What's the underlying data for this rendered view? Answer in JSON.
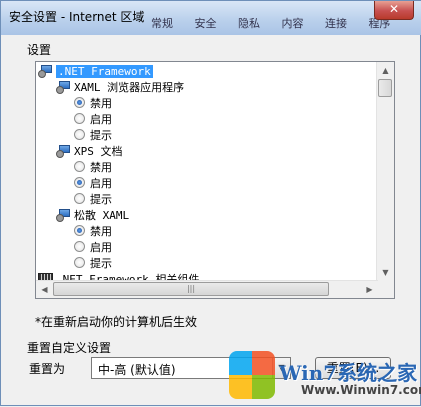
{
  "window": {
    "title": "安全设置 - Internet 区域",
    "close_glyph": "✕",
    "background_tabs": [
      "常规",
      "安全",
      "隐私",
      "内容",
      "连接",
      "程序"
    ]
  },
  "settings": {
    "label": "设置",
    "tree": [
      {
        "kind": "category",
        "label": ".NET Framework",
        "icon": "settings-category-icon",
        "selected": true
      },
      {
        "kind": "subcategory",
        "label": "XAML 浏览器应用程序",
        "icon": "settings-category-icon"
      },
      {
        "kind": "option",
        "label": "禁用",
        "checked": true
      },
      {
        "kind": "option",
        "label": "启用",
        "checked": false
      },
      {
        "kind": "option",
        "label": "提示",
        "checked": false
      },
      {
        "kind": "subcategory",
        "label": "XPS 文档",
        "icon": "settings-category-icon"
      },
      {
        "kind": "option",
        "label": "禁用",
        "checked": false
      },
      {
        "kind": "option",
        "label": "启用",
        "checked": true
      },
      {
        "kind": "option",
        "label": "提示",
        "checked": false
      },
      {
        "kind": "subcategory",
        "label": "松散 XAML",
        "icon": "settings-category-icon"
      },
      {
        "kind": "option",
        "label": "禁用",
        "checked": true
      },
      {
        "kind": "option",
        "label": "启用",
        "checked": false
      },
      {
        "kind": "option",
        "label": "提示",
        "checked": false
      },
      {
        "kind": "category",
        "label": ".NET Framework 相关组件",
        "icon": "component-category-icon"
      }
    ],
    "note": "*在重新启动你的计算机后生效"
  },
  "reset": {
    "legend": "重置自定义设置",
    "reset_to_label": "重置为",
    "level_value": "中-高 (默认值)",
    "reset_button": "重置(E)..."
  },
  "watermark": {
    "brand": "Win7系统之家",
    "url": "Www.Winwin7.com"
  }
}
